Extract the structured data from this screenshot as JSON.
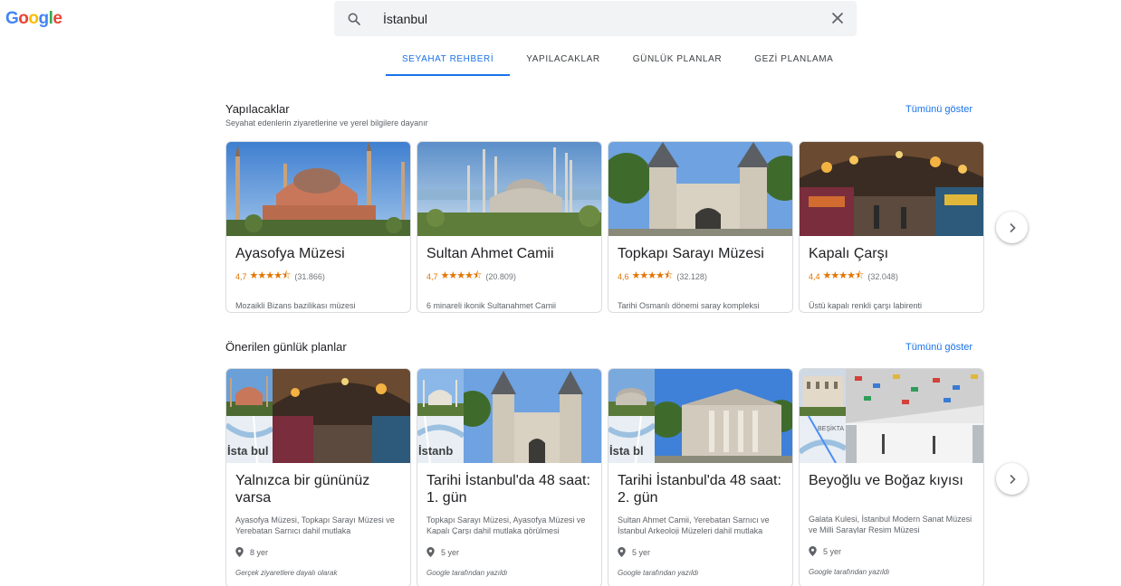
{
  "logo": "Google",
  "search": {
    "value": "İstanbul"
  },
  "tabs": [
    "SEYAHAT REHBERİ",
    "YAPILACAKLAR",
    "GÜNLÜK PLANLAR",
    "GEZİ PLANLAMA"
  ],
  "things": {
    "title": "Yapılacaklar",
    "subtitle": "Seyahat edenlerin ziyaretlerine ve yerel bilgilere dayanır",
    "show_all": "Tümünü göster",
    "cards": [
      {
        "title": "Ayasofya Müzesi",
        "rating": "4,7",
        "stars": 4.7,
        "reviews": "(31.866)",
        "desc": "Mozaikli Bizans bazilikası müzesi"
      },
      {
        "title": "Sultan Ahmet Camii",
        "rating": "4,7",
        "stars": 4.7,
        "reviews": "(20.809)",
        "desc": "6 minareli ikonik Sultanahmet Camii"
      },
      {
        "title": "Topkapı Sarayı Müzesi",
        "rating": "4,6",
        "stars": 4.6,
        "reviews": "(32.128)",
        "desc": "Tarihi Osmanlı dönemi saray kompleksi"
      },
      {
        "title": "Kapalı Çarşı",
        "rating": "4,4",
        "stars": 4.4,
        "reviews": "(32.048)",
        "desc": "Üstü kapalı renkli çarşı labirenti"
      }
    ]
  },
  "plans": {
    "title": "Önerilen günlük planlar",
    "show_all": "Tümünü göster",
    "cards": [
      {
        "title": "Yalnızca bir gününüz varsa",
        "desc": "Ayasofya Müzesi, Topkapı Sarayı Müzesi ve Yerebatan Sarnıcı dahil mutlaka",
        "places": "8 yer",
        "author": "Gerçek ziyaretlere dayalı olarak",
        "map_label": "İsta   bul"
      },
      {
        "title": "Tarihi İstanbul'da 48 saat: 1. gün",
        "desc": "Topkapı Sarayı Müzesi, Ayasofya Müzesi ve Kapalı Çarşı dahil mutlaka görülmesi",
        "places": "5 yer",
        "author": "Google tarafından yazıldı",
        "map_label": "İstanb"
      },
      {
        "title": "Tarihi İstanbul'da 48 saat: 2. gün",
        "desc": "Sultan Ahmet Camii, Yerebatan Sarnıcı ve İstanbul Arkeoloji Müzeleri dahil mutlaka",
        "places": "5 yer",
        "author": "Google tarafından yazıldı",
        "map_label": "İsta  bl"
      },
      {
        "title": "Beyoğlu ve Boğaz kıyısı",
        "desc": "Galata Kulesi, İstanbul Modern Sanat Müzesi ve Milli Saraylar Resim Müzesi",
        "places": "5 yer",
        "author": "Google tarafından yazıldı",
        "map_label": "BEŞİKTA"
      }
    ]
  },
  "colors": {
    "accent": "#1a73e8",
    "star": "#e37400"
  }
}
